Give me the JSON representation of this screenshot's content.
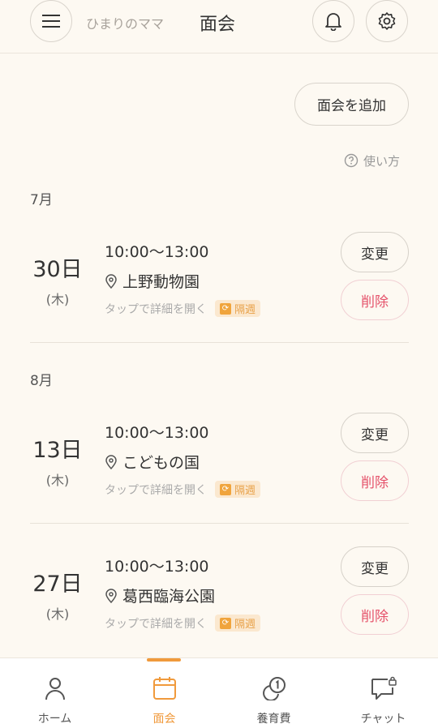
{
  "header": {
    "user_name": "ひまりのママ",
    "title": "面会"
  },
  "toolbar": {
    "add_label": "面会を追加",
    "help_label": "使い方"
  },
  "months": [
    {
      "label": "7月",
      "entries": [
        {
          "day": "30日",
          "weekday": "(木)",
          "time": "10:00〜13:00",
          "place": "上野動物園",
          "detail": "タップで詳細を開く",
          "badge": "隔週",
          "change": "変更",
          "delete": "削除"
        }
      ]
    },
    {
      "label": "8月",
      "entries": [
        {
          "day": "13日",
          "weekday": "(木)",
          "time": "10:00〜13:00",
          "place": "こどもの国",
          "detail": "タップで詳細を開く",
          "badge": "隔週",
          "change": "変更",
          "delete": "削除"
        },
        {
          "day": "27日",
          "weekday": "(木)",
          "time": "10:00〜13:00",
          "place": "葛西臨海公園",
          "detail": "タップで詳細を開く",
          "badge": "隔週",
          "change": "変更",
          "delete": "削除"
        }
      ]
    }
  ],
  "tabs": [
    {
      "label": "ホーム",
      "icon": "person-icon"
    },
    {
      "label": "面会",
      "icon": "calendar-icon"
    },
    {
      "label": "養育費",
      "icon": "coins-icon"
    },
    {
      "label": "チャット",
      "icon": "chat-lock-icon"
    }
  ],
  "colors": {
    "background": "#fdf9f2",
    "accent": "#f09a3c",
    "delete": "#e5536b",
    "badge_bg": "#fbe8cf"
  }
}
